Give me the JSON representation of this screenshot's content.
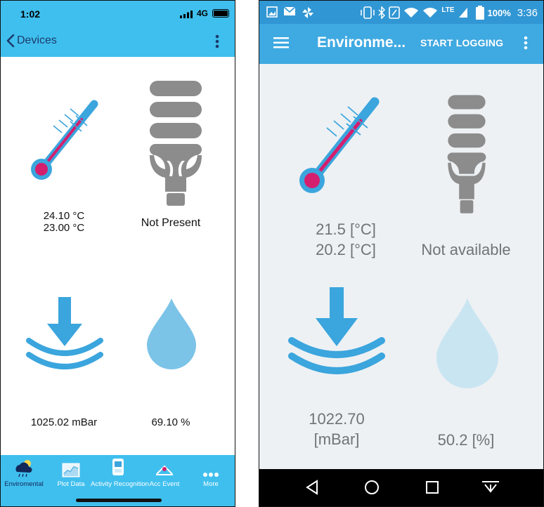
{
  "ios": {
    "status": {
      "time": "1:02",
      "network": "4G"
    },
    "nav": {
      "back_label": "Devices"
    },
    "readings": {
      "temperature_1": "24.10 °C",
      "temperature_2": "23.00 °C",
      "light": "Not Present",
      "pressure": "1025.02 mBar",
      "humidity": "69.10 %"
    },
    "tabs": [
      {
        "label": "Enviromental",
        "icon": "weather-cloud-icon",
        "active": true
      },
      {
        "label": "Plot Data",
        "icon": "chart-icon"
      },
      {
        "label": "Activity Recognition",
        "icon": "activity-icon"
      },
      {
        "label": "Acc Event",
        "icon": "acc-event-icon"
      },
      {
        "label": "More",
        "icon": "more-dots-icon"
      }
    ]
  },
  "android": {
    "status": {
      "battery": "100%",
      "time": "3:36",
      "network": "LTE"
    },
    "appbar": {
      "title": "Environme...",
      "action": "START LOGGING"
    },
    "readings": {
      "temperature_1": "21.5 [°C]",
      "temperature_2": "20.2 [°C]",
      "light": "Not available",
      "pressure_value": "1022.70",
      "pressure_unit": "[mBar]",
      "humidity": "50.2 [%]"
    }
  },
  "colors": {
    "ios_bar": "#3fbfee",
    "android_status": "#3197d4",
    "android_appbar": "#3fa9e1",
    "icon_blue": "#3ba5dd",
    "thermo_red": "#d41f6e",
    "bulb_gray": "#8c8c8c",
    "drop_ios": "#7cc3e8",
    "drop_android": "#c9e5f1"
  }
}
